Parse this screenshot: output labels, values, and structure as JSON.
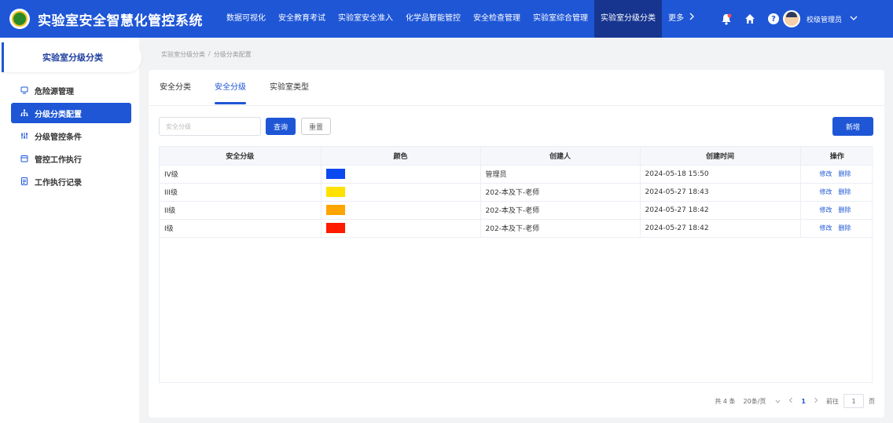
{
  "header": {
    "title": "实验室安全智慧化管控系统",
    "nav": [
      {
        "label": "数据可视化",
        "active": false
      },
      {
        "label": "安全教育考试",
        "active": false
      },
      {
        "label": "实验室安全准入",
        "active": false
      },
      {
        "label": "化学品智能管控",
        "active": false
      },
      {
        "label": "安全检查管理",
        "active": false
      },
      {
        "label": "实验室综合管理",
        "active": false
      },
      {
        "label": "实验室分级分类",
        "active": true
      }
    ],
    "more_label": "更多",
    "more_icon": "chevron-right-icon",
    "user_name": "校级管理员",
    "accent_color": "#1e56d6",
    "active_nav_color": "#17358f",
    "notification_color": "#ff4d4f"
  },
  "sidebar": {
    "title": "实验室分级分类",
    "items": [
      {
        "label": "危险源管理",
        "icon": "monitor-icon",
        "active": false
      },
      {
        "label": "分级分类配置",
        "icon": "hierarchy-icon",
        "active": true
      },
      {
        "label": "分级管控条件",
        "icon": "sliders-icon",
        "active": false
      },
      {
        "label": "管控工作执行",
        "icon": "calendar-icon",
        "active": false
      },
      {
        "label": "工作执行记录",
        "icon": "document-icon",
        "active": false
      }
    ]
  },
  "breadcrumb": {
    "parent": "实验室分级分类",
    "separator": "/",
    "current": "分级分类配置"
  },
  "tabs": [
    {
      "label": "安全分类",
      "active": false
    },
    {
      "label": "安全分级",
      "active": true
    },
    {
      "label": "实验室类型",
      "active": false
    }
  ],
  "toolbar": {
    "search_placeholder": "安全分级",
    "query_label": "查询",
    "reset_label": "重置",
    "add_label": "新增"
  },
  "table": {
    "columns": [
      "安全分级",
      "颜色",
      "创建人",
      "创建时间",
      "操作"
    ],
    "rows": [
      {
        "level": "IV级",
        "color": "#0a48f0",
        "creator": "管理员",
        "created": "2024-05-18 15:50"
      },
      {
        "level": "III级",
        "color": "#ffe100",
        "creator": "202-本及下-老师",
        "created": "2024-05-27 18:43"
      },
      {
        "level": "II级",
        "color": "#ffa500",
        "creator": "202-本及下-老师",
        "created": "2024-05-27 18:42"
      },
      {
        "level": "I级",
        "color": "#ff1a00",
        "creator": "202-本及下-老师",
        "created": "2024-05-27 18:42"
      }
    ],
    "edit_label": "修改",
    "delete_label": "删除"
  },
  "pager": {
    "total": "共 4 条",
    "page_size": "20条/页",
    "current_page": "1",
    "goto_label": "前往",
    "goto_value": "1",
    "page_unit": "页"
  }
}
